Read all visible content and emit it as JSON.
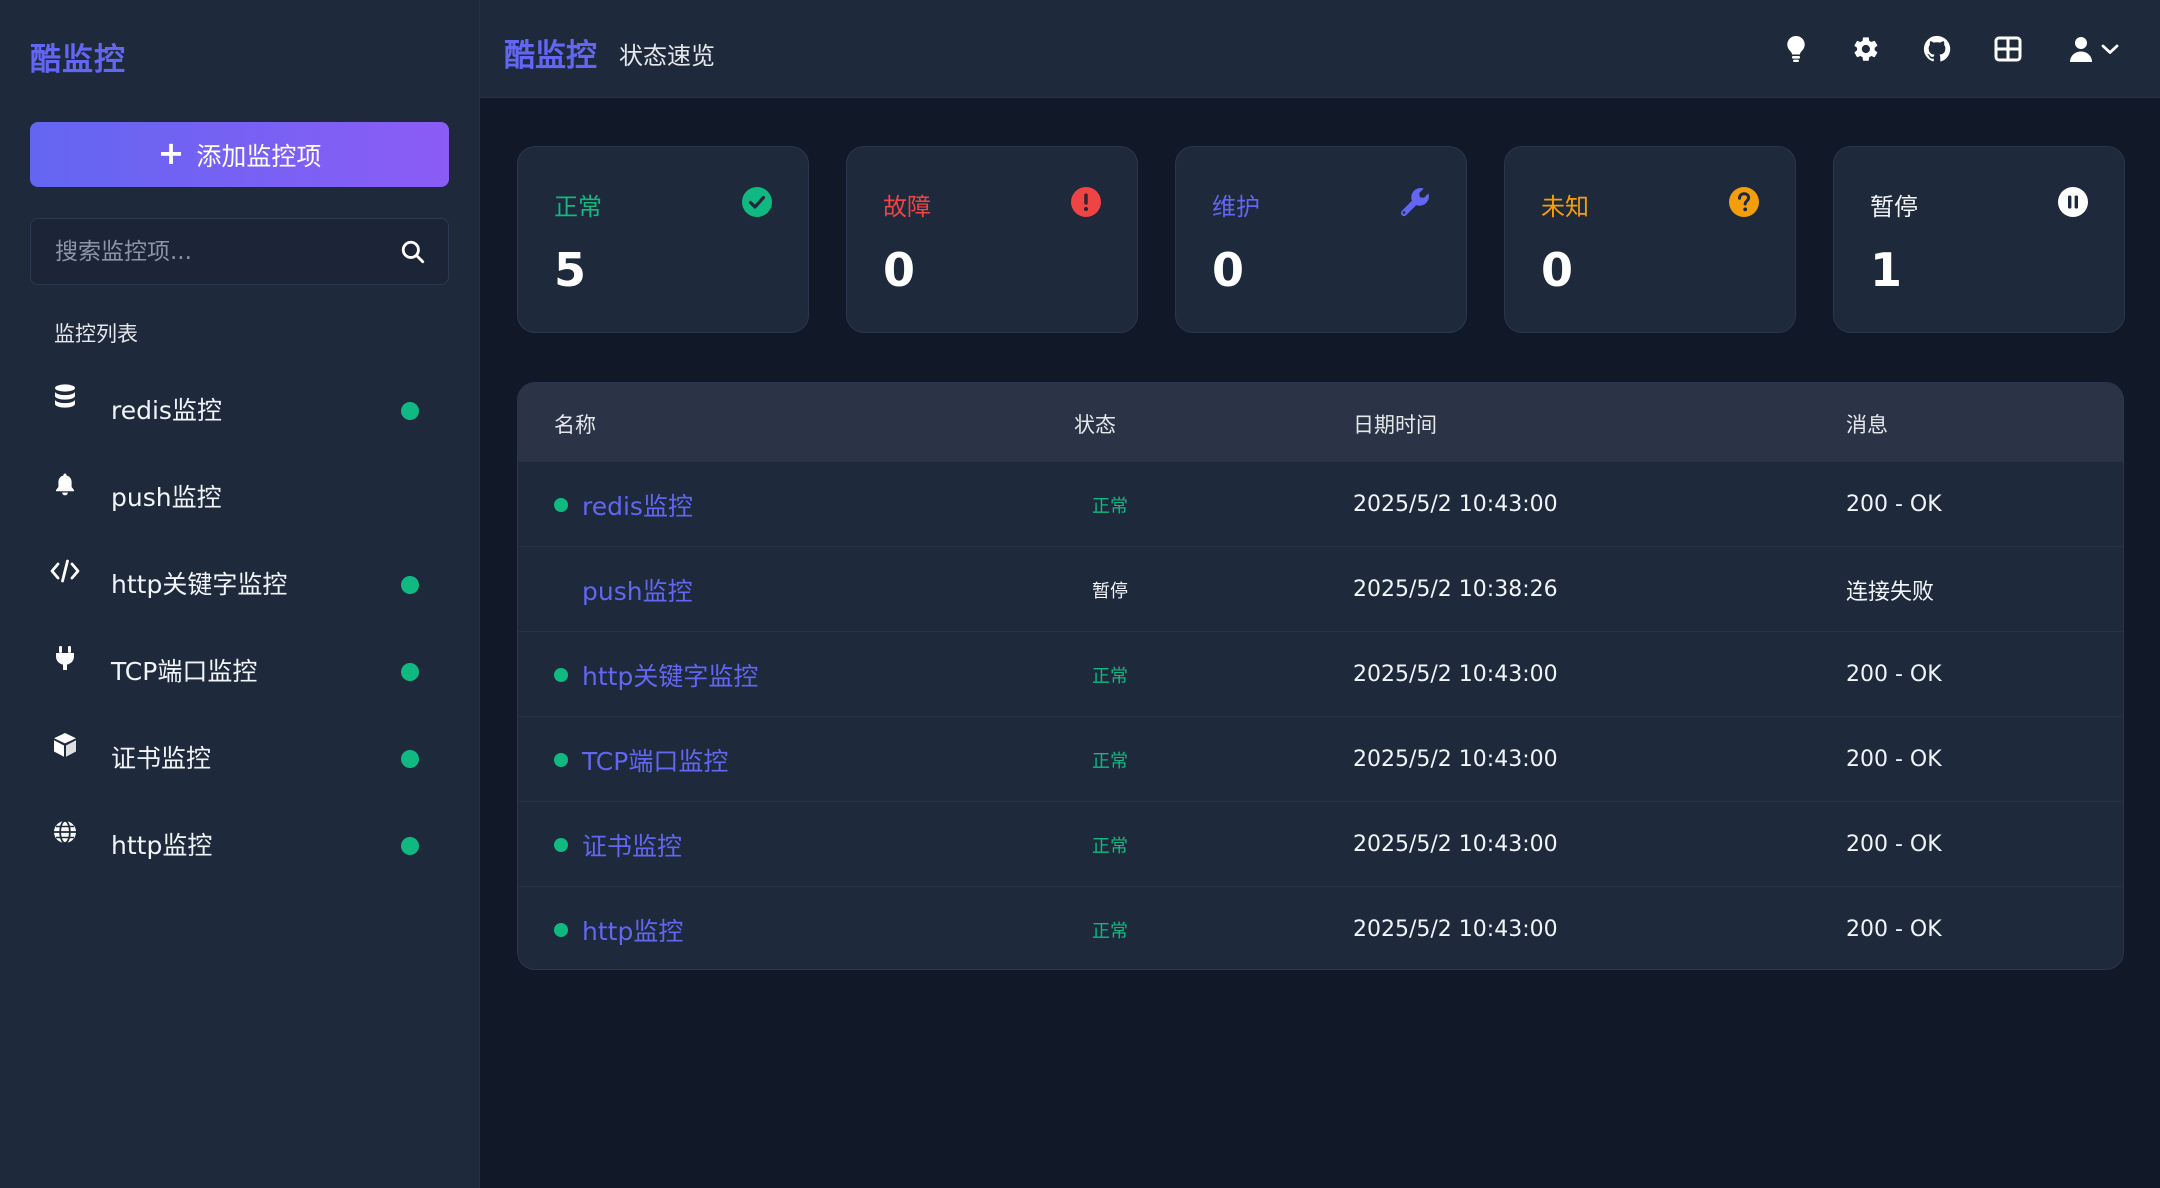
{
  "brand": "酷监控",
  "sidebar": {
    "add_button_label": "添加监控项",
    "search_placeholder": "搜索监控项...",
    "list_heading": "监控列表",
    "items": [
      {
        "label": "redis监控",
        "icon": "database-icon",
        "active": true
      },
      {
        "label": "push监控",
        "icon": "bell-icon",
        "active": false
      },
      {
        "label": "http关键字监控",
        "icon": "code-icon",
        "active": true
      },
      {
        "label": "TCP端口监控",
        "icon": "plug-icon",
        "active": true
      },
      {
        "label": "证书监控",
        "icon": "cube-icon",
        "active": true
      },
      {
        "label": "http监控",
        "icon": "globe-icon",
        "active": true
      }
    ]
  },
  "header": {
    "brand": "酷监控",
    "subtitle": "状态速览",
    "icons": [
      "lightbulb-icon",
      "gear-icon",
      "github-icon",
      "grid-icon",
      "user-icon",
      "chevron-down-icon"
    ]
  },
  "stats": [
    {
      "label": "正常",
      "value": "5",
      "color": "#10b981",
      "icon": "check-circle-icon"
    },
    {
      "label": "故障",
      "value": "0",
      "color": "#ef4444",
      "icon": "alert-circle-icon"
    },
    {
      "label": "维护",
      "value": "0",
      "color": "#6366f1",
      "icon": "wrench-icon"
    },
    {
      "label": "未知",
      "value": "0",
      "color": "#f59e0b",
      "icon": "question-circle-icon"
    },
    {
      "label": "暂停",
      "value": "1",
      "color": "#f1f5f9",
      "icon": "pause-circle-icon"
    }
  ],
  "table": {
    "headers": [
      "名称",
      "状态",
      "日期时间",
      "消息"
    ],
    "rows": [
      {
        "name": "redis监控",
        "status": "正常",
        "datetime": "2025/5/2 10:43:00",
        "message": "200 - OK"
      },
      {
        "name": "push监控",
        "status": "暂停",
        "datetime": "2025/5/2 10:38:26",
        "message": "连接失败"
      },
      {
        "name": "http关键字监控",
        "status": "正常",
        "datetime": "2025/5/2 10:43:00",
        "message": "200 - OK"
      },
      {
        "name": "TCP端口监控",
        "status": "正常",
        "datetime": "2025/5/2 10:43:00",
        "message": "200 - OK"
      },
      {
        "name": "证书监控",
        "status": "正常",
        "datetime": "2025/5/2 10:43:00",
        "message": "200 - OK"
      },
      {
        "name": "http监控",
        "status": "正常",
        "datetime": "2025/5/2 10:43:00",
        "message": "200 - OK"
      }
    ]
  },
  "colors": {
    "accent": "#6366f1",
    "success": "#10b981",
    "danger": "#ef4444",
    "warning": "#f59e0b"
  }
}
